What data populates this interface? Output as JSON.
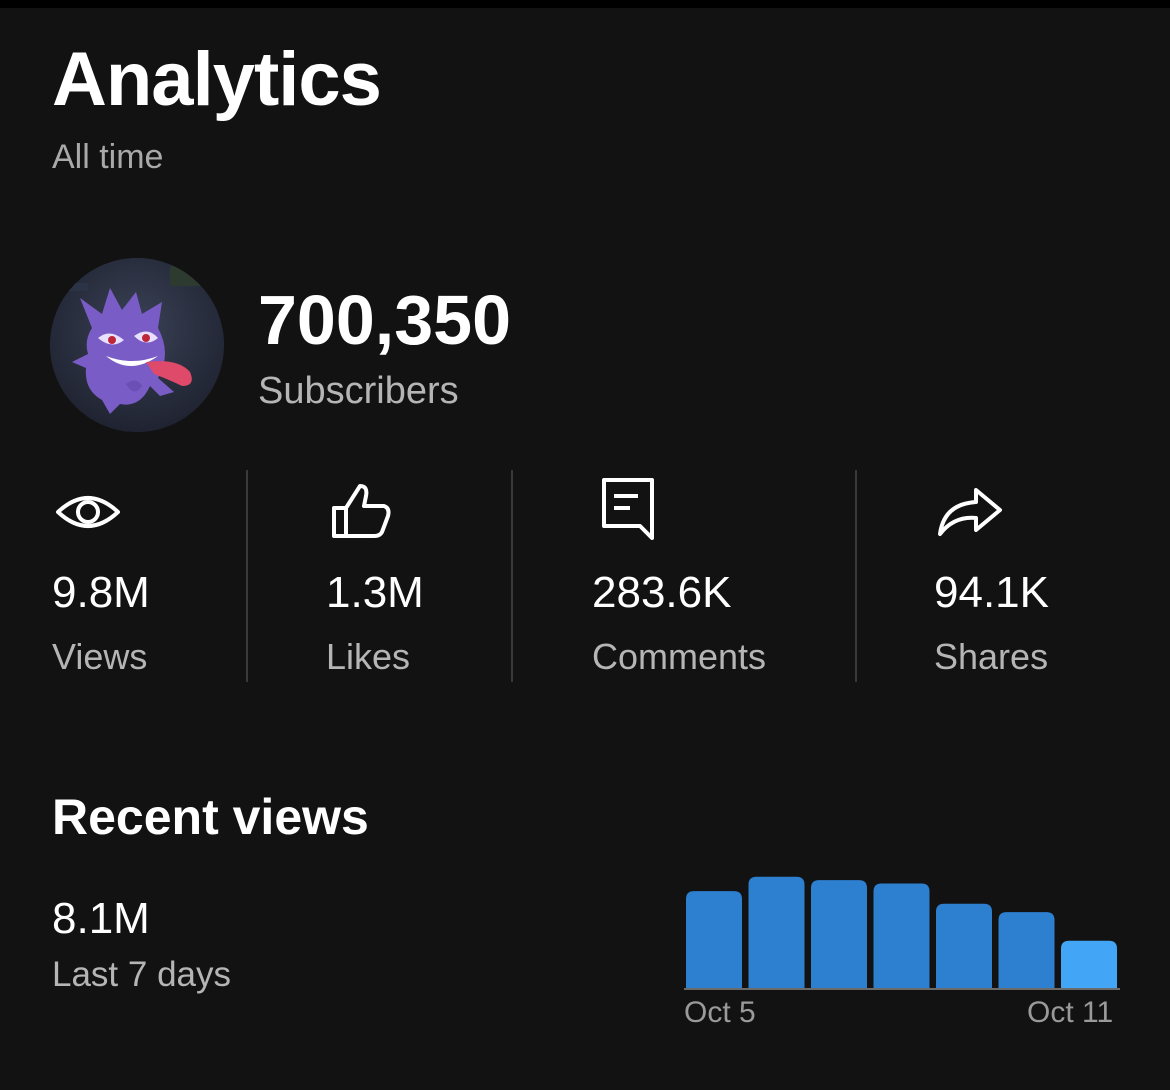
{
  "header": {
    "title": "Analytics",
    "period": "All time"
  },
  "channel": {
    "avatar_icon": "ghost-pokemon-avatar",
    "subscribers_value": "700,350",
    "subscribers_label": "Subscribers"
  },
  "stats": [
    {
      "icon": "eye-icon",
      "value": "9.8M",
      "label": "Views"
    },
    {
      "icon": "thumbs-up-icon",
      "value": "1.3M",
      "label": "Likes"
    },
    {
      "icon": "comment-icon",
      "value": "283.6K",
      "label": "Comments"
    },
    {
      "icon": "share-icon",
      "value": "94.1K",
      "label": "Shares"
    }
  ],
  "recent": {
    "title": "Recent views",
    "value": "8.1M",
    "label": "Last 7 days"
  },
  "colors": {
    "bar": "#2d7fd0",
    "bar_highlight": "#42a5f5",
    "background": "#121212"
  },
  "chart_data": {
    "type": "bar",
    "x_tick_labels": [
      "Oct 5",
      "Oct 11"
    ],
    "values": [
      1.15,
      1.32,
      1.28,
      1.24,
      1.0,
      0.9,
      0.56
    ],
    "ylim": [
      0,
      1.4
    ],
    "highlight_index": 6
  }
}
